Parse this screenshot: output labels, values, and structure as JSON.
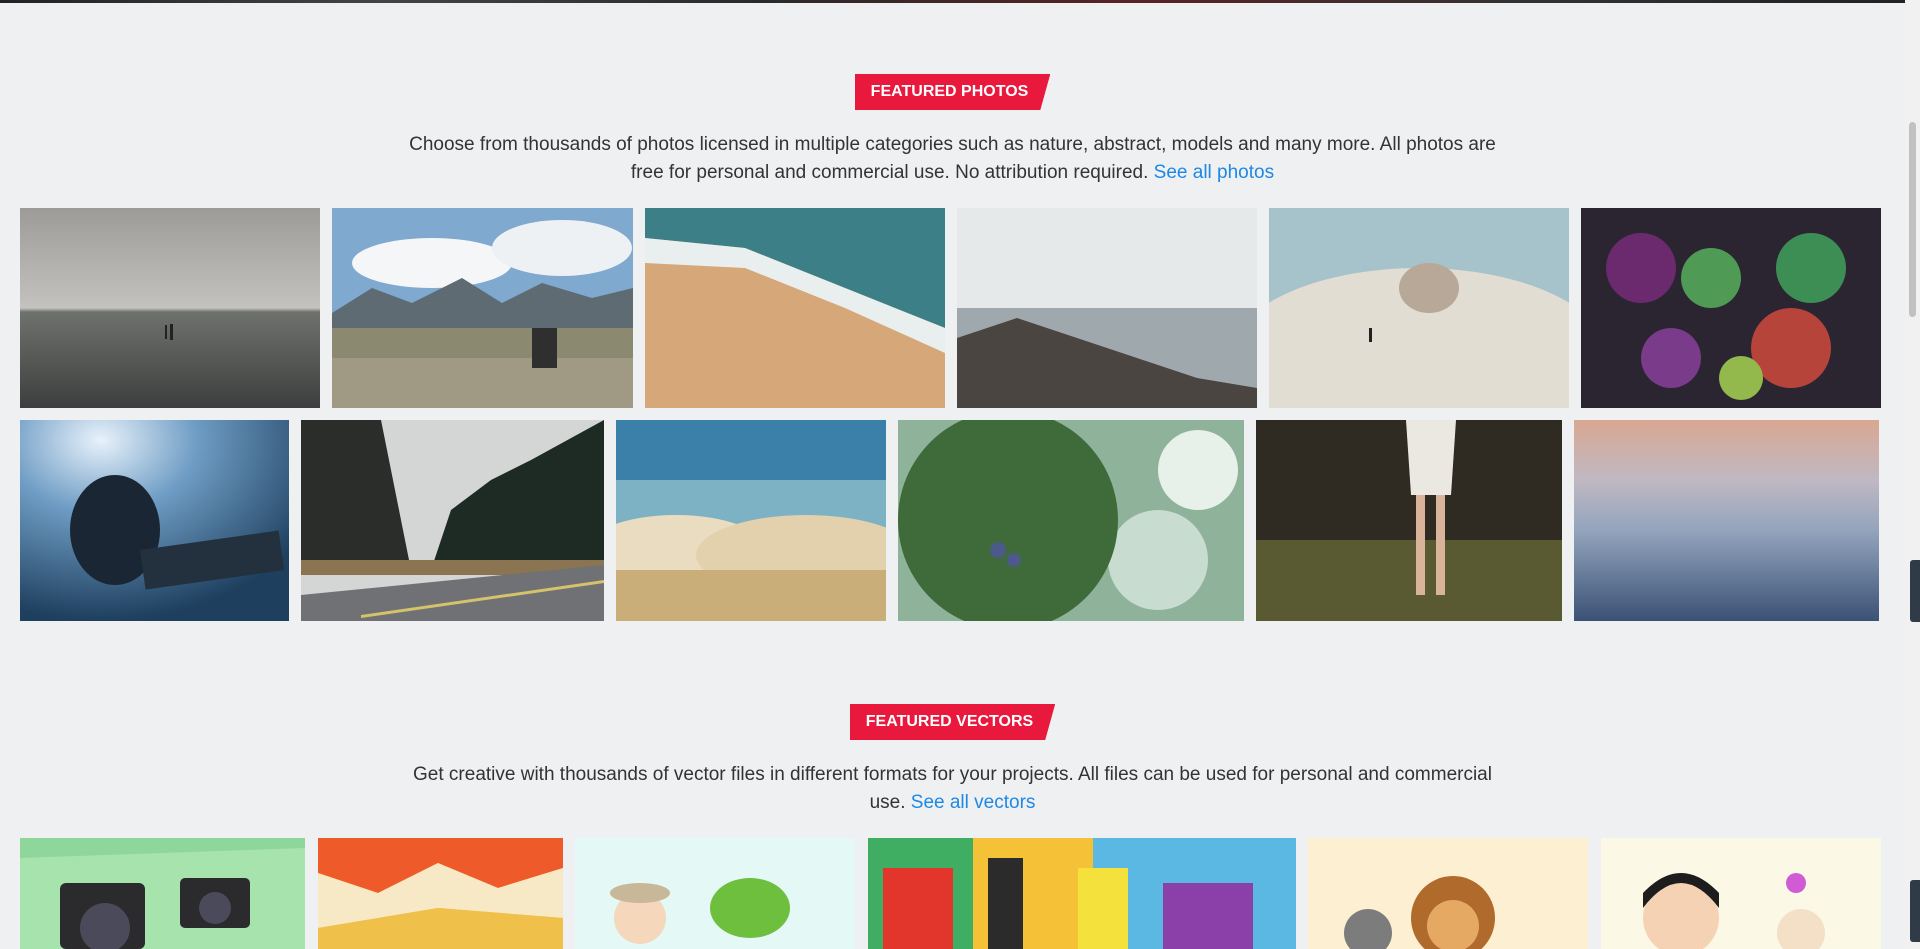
{
  "photos": {
    "badge": "FEATURED PHOTOS",
    "desc_text": "Choose from thousands of photos licensed in multiple categories such as nature, abstract, models and many more. All photos are free for personal and commercial use. No attribution required. ",
    "link_label": "See all photos"
  },
  "vectors": {
    "badge": "FEATURED VECTORS",
    "desc_text": "Get creative with thousands of vector files in different formats for your projects. All files can be used for personal and commercial use. ",
    "link_label": "See all vectors"
  },
  "colors": {
    "accent": "#e8193c",
    "link": "#1e88e5",
    "background": "#eef0f1"
  },
  "photo_thumbnails": [
    "misty-lake",
    "mountain-hiker",
    "aerial-beach-wave",
    "rocky-coast",
    "sand-labyrinth",
    "succulents",
    "underwater-selfie",
    "forest-road",
    "clouds-above",
    "juniper-berries",
    "girl-white-dress-forest",
    "sunset-sea-fog"
  ],
  "vector_thumbnails": [
    "canon-cameras",
    "polygon-landscape",
    "cartoon-man-dragon",
    "shopping-bags-pos",
    "cartoon-lion-raccoon",
    "cartoon-kid"
  ]
}
